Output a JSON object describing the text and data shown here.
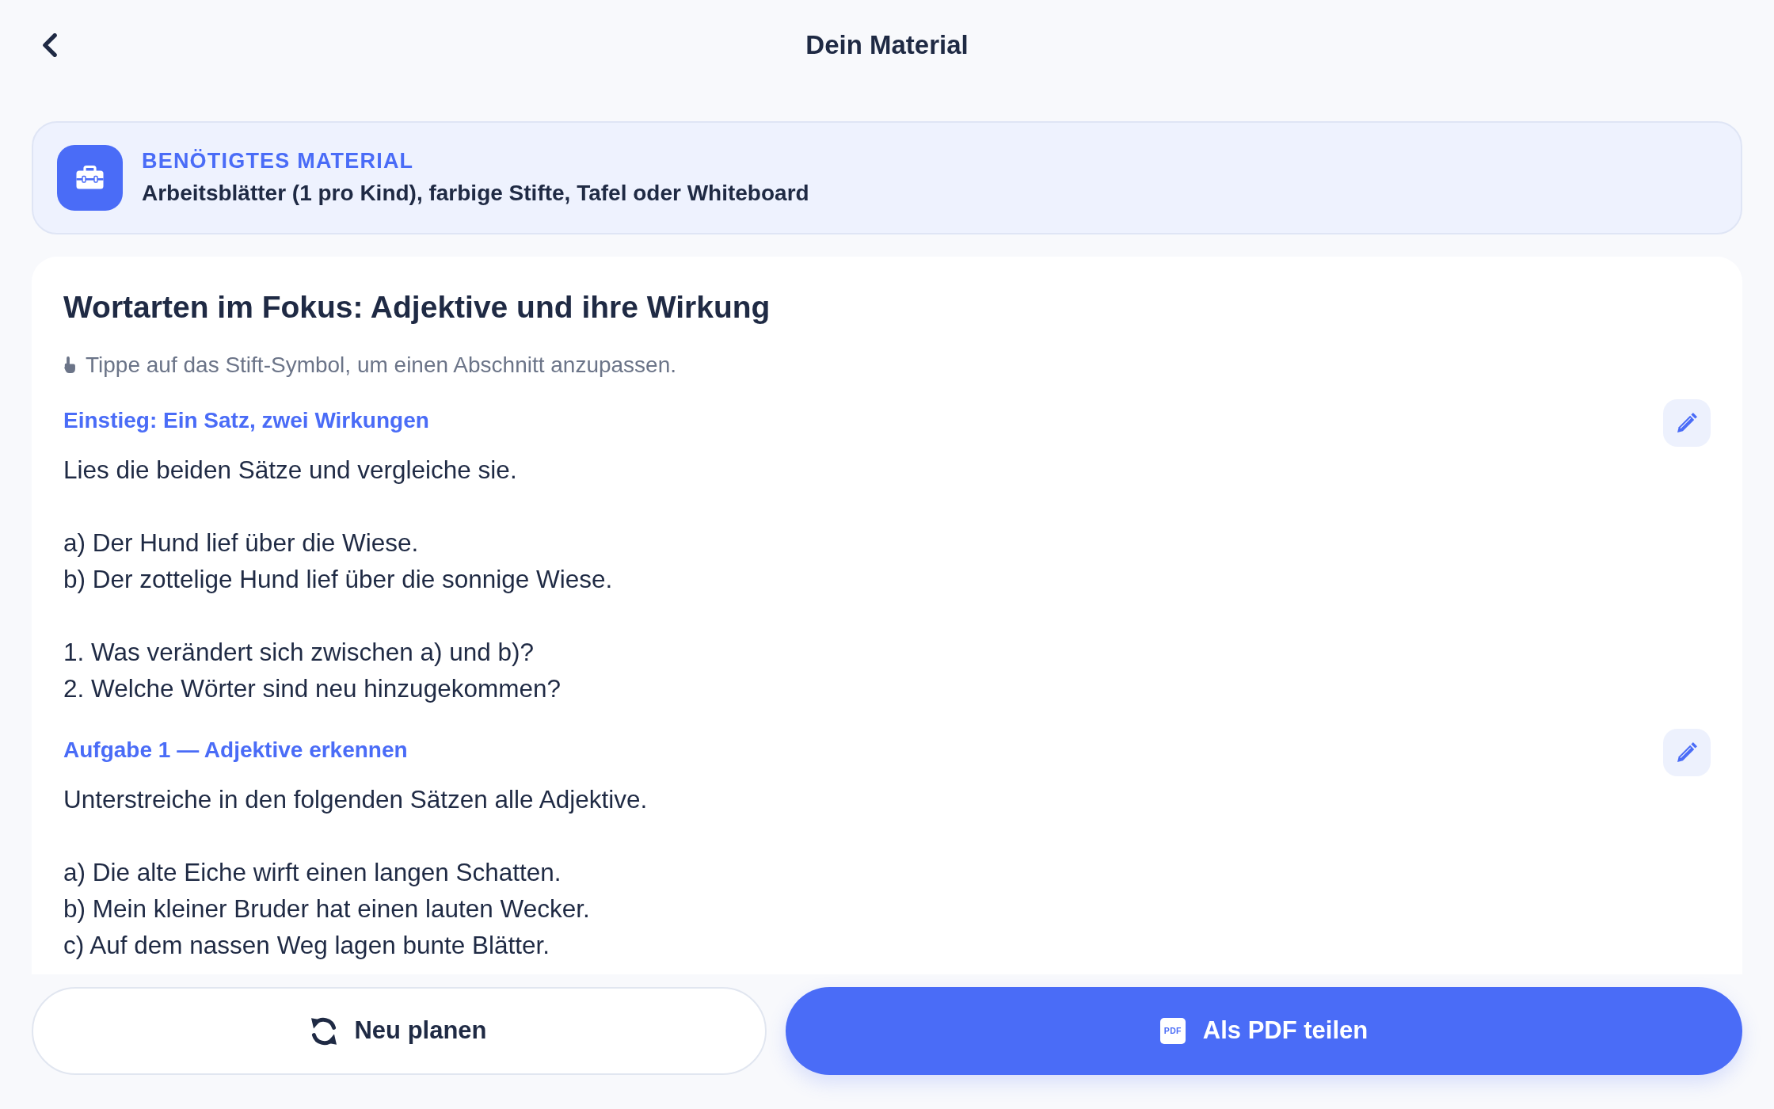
{
  "header": {
    "title": "Dein Material"
  },
  "material": {
    "label": "BENÖTIGTES MATERIAL",
    "text": "Arbeitsblätter (1 pro Kind), farbige Stifte, Tafel oder Whiteboard"
  },
  "worksheet": {
    "title": "Wortarten im Fokus: Adjektive und ihre Wirkung",
    "hint": "Tippe auf das Stift-Symbol, um einen Abschnitt anzupassen.",
    "sections": [
      {
        "heading": "Einstieg: Ein Satz, zwei Wirkungen",
        "paragraphs": [
          [
            "Lies die beiden Sätze und vergleiche sie."
          ],
          [
            "a) Der Hund lief über die Wiese.",
            "b) Der zottelige Hund lief über die sonnige Wiese."
          ],
          [
            "1. Was verändert sich zwischen a) und b)?",
            "2. Welche Wörter sind neu hinzugekommen?"
          ]
        ]
      },
      {
        "heading": "Aufgabe 1 — Adjektive erkennen",
        "paragraphs": [
          [
            "Unterstreiche in den folgenden Sätzen alle Adjektive."
          ],
          [
            "a) Die alte Eiche wirft einen langen Schatten.",
            "b) Mein kleiner Bruder hat einen lauten Wecker.",
            "c) Auf dem nassen Weg lagen bunte Blätter."
          ]
        ]
      }
    ]
  },
  "actions": [
    {
      "kind": "secondary",
      "label": "Neu planen"
    },
    {
      "kind": "primary",
      "label": "Als PDF teilen",
      "icon_text": "PDF"
    }
  ]
}
